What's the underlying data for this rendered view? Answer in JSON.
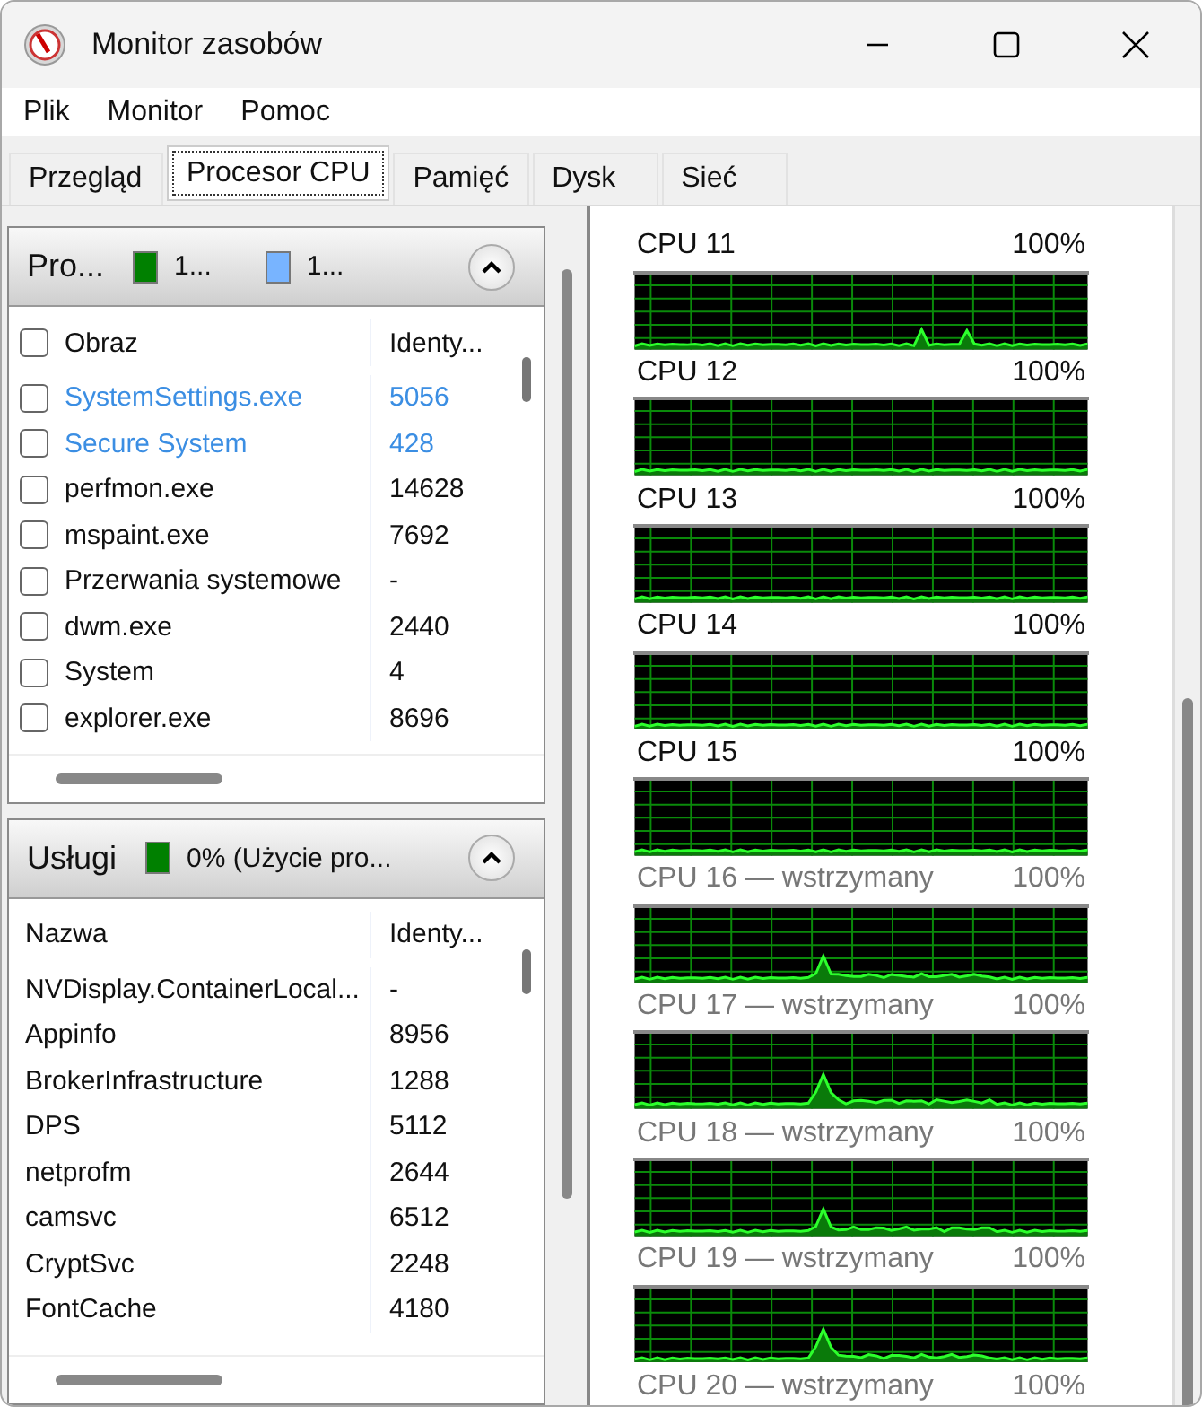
{
  "window": {
    "title": "Monitor zasobów"
  },
  "menu": [
    "Plik",
    "Monitor",
    "Pomoc"
  ],
  "tabs": [
    {
      "label": "Przegląd",
      "selected": false
    },
    {
      "label": "Procesor CPU",
      "selected": true
    },
    {
      "label": "Pamięć",
      "selected": false
    },
    {
      "label": "Dysk",
      "selected": false
    },
    {
      "label": "Sieć",
      "selected": false
    }
  ],
  "processes": {
    "title": "Pro...",
    "expanded": true,
    "legend": [
      {
        "label": "1...",
        "color": "#008000"
      },
      {
        "label": "1...",
        "color": "#78b4ff"
      }
    ],
    "columns": [
      "Obraz",
      "Identy..."
    ],
    "all_checked": false,
    "rows": [
      {
        "name": "SystemSettings.exe",
        "pid": "5056",
        "checked": false,
        "suspended": true
      },
      {
        "name": "Secure System",
        "pid": "428",
        "checked": false,
        "suspended": true
      },
      {
        "name": "perfmon.exe",
        "pid": "14628",
        "checked": false,
        "suspended": false
      },
      {
        "name": "mspaint.exe",
        "pid": "7692",
        "checked": false,
        "suspended": false
      },
      {
        "name": "Przerwania systemowe",
        "pid": "-",
        "checked": false,
        "suspended": false
      },
      {
        "name": "dwm.exe",
        "pid": "2440",
        "checked": false,
        "suspended": false
      },
      {
        "name": "System",
        "pid": "4",
        "checked": false,
        "suspended": false
      },
      {
        "name": "explorer.exe",
        "pid": "8696",
        "checked": false,
        "suspended": false
      }
    ]
  },
  "services": {
    "title": "Usługi",
    "expanded": true,
    "legend": [
      {
        "label": "0% (Użycie pro...",
        "color": "#008000"
      }
    ],
    "columns": [
      "Nazwa",
      "Identy..."
    ],
    "rows": [
      {
        "name": "NVDisplay.ContainerLocal...",
        "pid": "-"
      },
      {
        "name": "Appinfo",
        "pid": "8956"
      },
      {
        "name": "BrokerInfrastructure",
        "pid": "1288"
      },
      {
        "name": "DPS",
        "pid": "5112"
      },
      {
        "name": "netprofm",
        "pid": "2644"
      },
      {
        "name": "camsvc",
        "pid": "6512"
      },
      {
        "name": "CryptSvc",
        "pid": "2248"
      },
      {
        "name": "FontCache",
        "pid": "4180"
      }
    ]
  },
  "cpus": [
    {
      "label": "CPU 11",
      "reading": "100%",
      "suspended": false
    },
    {
      "label": "CPU 12",
      "reading": "100%",
      "suspended": false
    },
    {
      "label": "CPU 13",
      "reading": "100%",
      "suspended": false
    },
    {
      "label": "CPU 14",
      "reading": "100%",
      "suspended": false
    },
    {
      "label": "CPU 15",
      "reading": "100%",
      "suspended": false
    },
    {
      "label": "CPU 16 — wstrzymany",
      "reading": "100%",
      "suspended": true
    },
    {
      "label": "CPU 17 — wstrzymany",
      "reading": "100%",
      "suspended": true
    },
    {
      "label": "CPU 18 — wstrzymany",
      "reading": "100%",
      "suspended": true
    },
    {
      "label": "CPU 19 — wstrzymany",
      "reading": "100%",
      "suspended": true
    },
    {
      "label": "CPU 20 — wstrzymany",
      "reading": "100%",
      "suspended": true
    }
  ]
}
